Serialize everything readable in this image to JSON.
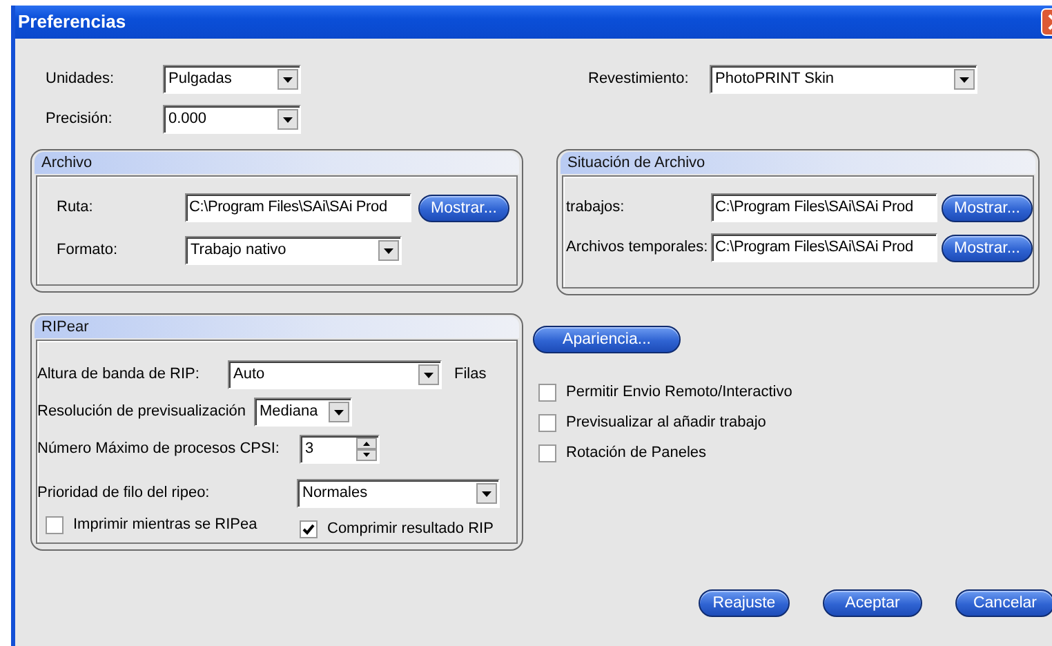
{
  "window": {
    "title": "Preferencias"
  },
  "general": [
    {
      "label": "Unidades:",
      "value": "Pulgadas"
    },
    {
      "label": "Precisión:",
      "value": "0.000"
    }
  ],
  "skin": {
    "label": "Revestimiento:",
    "value": "PhotoPRINT Skin"
  },
  "archivo": {
    "title": "Archivo",
    "rows": [
      {
        "kind": "text",
        "label": "Ruta:",
        "value": "C:\\Program Files\\SAi\\SAi Prod",
        "button": "Mostrar..."
      },
      {
        "kind": "select",
        "label": "Formato:",
        "value": "Trabajo nativo"
      }
    ]
  },
  "situacion": {
    "title": "Situación de Archivo",
    "rows": [
      {
        "kind": "text",
        "label": "trabajos:",
        "value": "C:\\Program Files\\SAi\\SAi Prod",
        "button": "Mostrar..."
      },
      {
        "kind": "text",
        "label": "Archivos temporales:",
        "value": "C:\\Program Files\\SAi\\SAi Prod",
        "button": "Mostrar..."
      }
    ]
  },
  "ripear": {
    "title": "RIPear",
    "rows": [
      {
        "kind": "select",
        "label": "Altura de banda de RIP:",
        "value": "Auto",
        "suffix": "Filas"
      },
      {
        "kind": "select",
        "label": "Resolución de previsualización",
        "value": "Mediana"
      },
      {
        "kind": "spin",
        "label": "Número Máximo de procesos CPSI:",
        "value": "3"
      },
      {
        "kind": "select",
        "label": "Prioridad de filo del ripeo:",
        "value": "Normales"
      }
    ],
    "checkboxes": [
      {
        "label": "Imprimir mientras se RIPea",
        "checked": false
      },
      {
        "label": "Comprimir resultado RIP",
        "checked": true
      }
    ]
  },
  "appearance_button": "Apariencia...",
  "options": [
    {
      "label": "Permitir Envio Remoto/Interactivo",
      "checked": false
    },
    {
      "label": "Previsualizar al añadir trabajo",
      "checked": false
    },
    {
      "label": "Rotación de Paneles",
      "checked": false
    }
  ],
  "buttons": [
    "Reajuste",
    "Aceptar",
    "Cancelar"
  ]
}
